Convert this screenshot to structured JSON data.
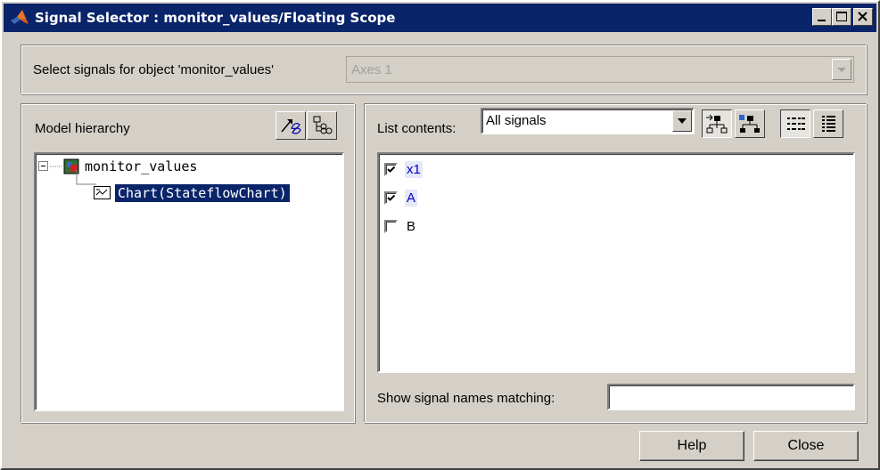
{
  "window": {
    "title": "Signal Selector : monitor_values/Floating Scope",
    "controls": [
      "minimize-icon",
      "maximize-icon",
      "close-icon"
    ]
  },
  "top": {
    "label": "Select signals for object 'monitor_values'",
    "axes_value": "Axes 1"
  },
  "left_panel": {
    "label": "Model hierarchy",
    "toolbar_icons": [
      "open-model-icon",
      "signal-hierarchy-icon"
    ],
    "tree": {
      "root": {
        "expander": "⊟",
        "label": "monitor_values",
        "icon": "model-icon"
      },
      "child": {
        "label": "Chart(StateflowChart)",
        "icon": "stateflow-chart-icon",
        "selected": true
      }
    }
  },
  "right_panel": {
    "label": "List contents:",
    "list_contents_value": "All signals",
    "toolbar_icons": [
      "show-all-subsystems-icon",
      "show-library-links-icon",
      "list-view-icon",
      "details-view-icon"
    ],
    "signals": [
      {
        "name": "x1",
        "checked": true,
        "highlighted": true
      },
      {
        "name": "A",
        "checked": true,
        "highlighted": true
      },
      {
        "name": "B",
        "checked": false,
        "highlighted": false
      }
    ],
    "filter_label": "Show signal names matching:",
    "filter_value": ""
  },
  "buttons": {
    "help": "Help",
    "close": "Close"
  },
  "colors": {
    "title_bar": "#0a246a",
    "window_bg": "#d4d0c8",
    "selection": "#0a246a",
    "signal_highlight_text": "#0000cc"
  }
}
